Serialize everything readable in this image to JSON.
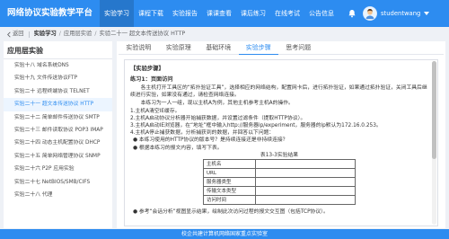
{
  "app": {
    "title": "网络协议实验教学平台"
  },
  "nav": {
    "items": [
      {
        "label": "实验学习",
        "active": true
      },
      {
        "label": "课程下载"
      },
      {
        "label": "实验报告"
      },
      {
        "label": "课课查看"
      },
      {
        "label": "课后练习"
      },
      {
        "label": "在线考试"
      },
      {
        "label": "公告信息"
      }
    ]
  },
  "header_icons": {
    "notifications": "bell-icon",
    "user_menu": "caret-down-icon"
  },
  "user": {
    "name": "studentwang"
  },
  "breadcrumb": {
    "back_label": "返回",
    "back_icon": "chevron-left-icon",
    "separator": "/",
    "items": [
      "实验学习",
      "应用层实验",
      "实验二十一 超文本传送协议 HTTP"
    ]
  },
  "sidebar": {
    "title": "应用层实验",
    "active_index": 3,
    "items": [
      "实验十八 域名系统DNS",
      "实验十九 文件传送协议FTP",
      "实验二十 远程终端协议 TELNET",
      "实验二十一 超文本传送协议 HTTP",
      "实验二十二 简单邮件传送协议 SMTP",
      "实验二十三 邮件读取协议 POP3 IMAP",
      "实验二十四 动态主机配置协议 DHCP",
      "实验二十五 简单网络管理协议 SNMP",
      "实验二十六 P2P 应用实验",
      "实验二十七 NetBIOS/SMB/CIFS",
      "实验二十八 代理"
    ]
  },
  "tabs": {
    "active_index": 3,
    "items": [
      "实验说明",
      "实验原理",
      "基础环境",
      "实验步骤",
      "思考问题"
    ]
  },
  "content": {
    "heading": "【实验步骤】",
    "exercise_title": "练习1：页面访问",
    "intro": "各主机打开工具区的“拓扑验证工具”，选择相应的网络结构，配置网卡后，进行拓扑验证，如果通过拓扑验证，关闭工具后继续进行实验，如果没有通过，请检查网络连接。",
    "note": "本练习为一人一组，现以主机A为例，其他主机参考主机A的操作。",
    "steps": [
      "1.主机A清空IE缓存。",
      "2.主机A启动协议分析器开始捕获数据，并设置过滤条件（提取HTTP协议）。",
      "3.主机A启动IE浏览器，在“地址”框中输入http://服务器ip/experiment，服务器的ip默认为172.16.0.253。",
      "4.主机A停止捕获数据，分析捕获到的数据，并回答以下问题："
    ],
    "questions": [
      "● 本练习使用的HTTP协议的版本号？是持续连接还是非持续连接？",
      "● 根据本练习的报文内容，填写下表。"
    ],
    "table": {
      "caption": "表13-3实验结果",
      "rows": [
        {
          "label": "主机名",
          "value": ""
        },
        {
          "label": "URL",
          "value": ""
        },
        {
          "label": "服务器类型",
          "value": ""
        },
        {
          "label": "传输文本类型",
          "value": ""
        },
        {
          "label": "访问时间",
          "value": ""
        }
      ]
    },
    "after_table": [
      "● 参考“会话分析”视图显示结果，绘制此次访问过程的报文交互图（包括TCP协议）。"
    ],
    "scrollbar": {
      "thumb_offset": 0,
      "thumb_fraction": 0.6
    }
  },
  "footer": {
    "text": "校企共建计算机网络国家重点实验室"
  },
  "colors": {
    "primary": "#2d8cf0",
    "nav_active": "#2677cc",
    "page_background": "#eef1f6",
    "active_background": "#ecf5ff"
  }
}
